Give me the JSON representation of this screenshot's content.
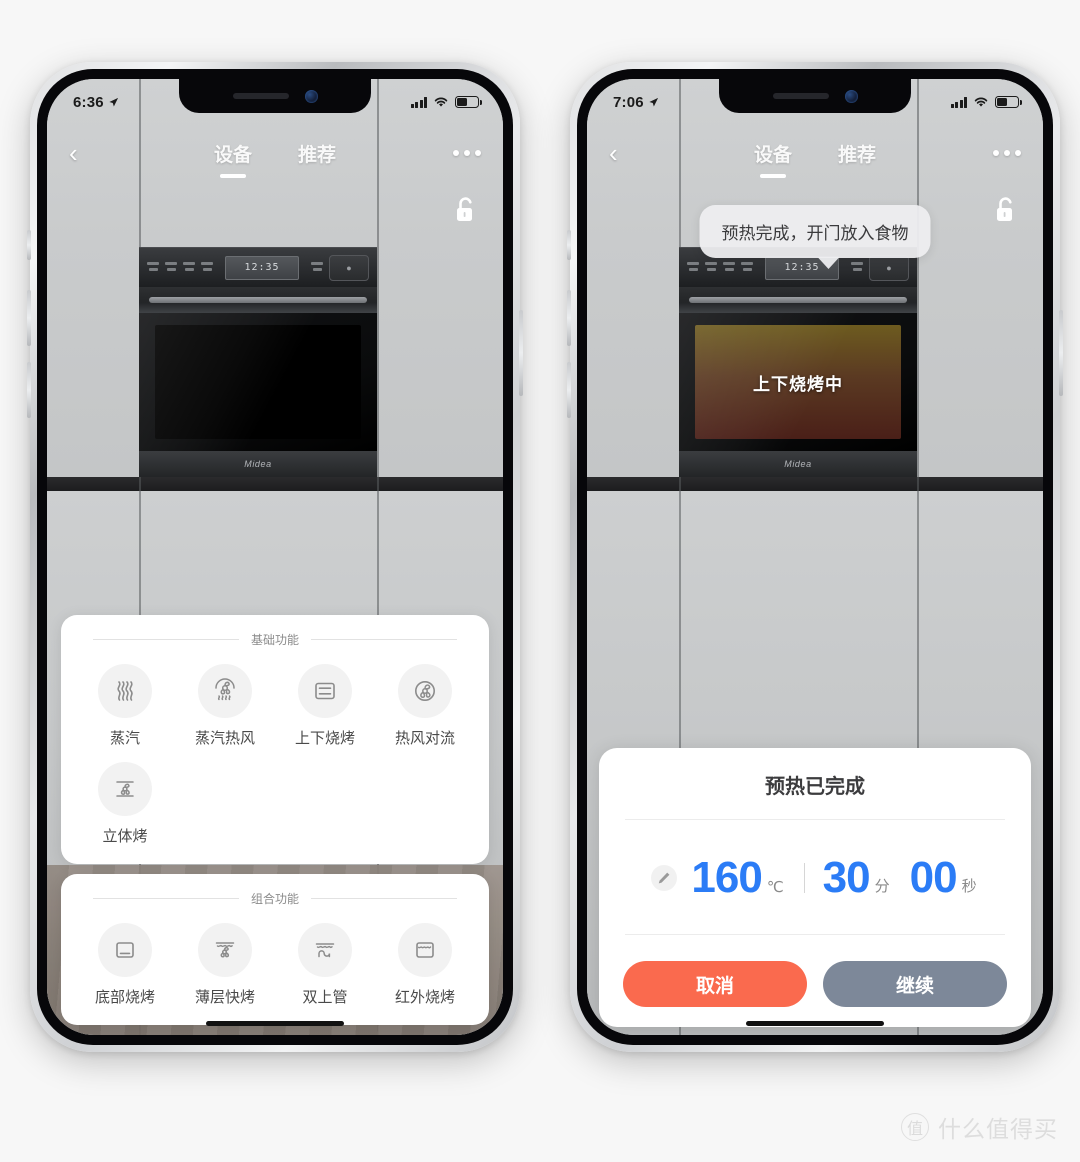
{
  "left_phone": {
    "status_bar": {
      "time": "6:36",
      "location_icon": "location-arrow-icon",
      "signal_icon": "cellular-bars-icon",
      "wifi_icon": "wifi-icon",
      "battery_icon": "battery-icon"
    },
    "navbar": {
      "back_icon": "chevron-left-icon",
      "tabs": [
        {
          "label": "设备",
          "active": true
        },
        {
          "label": "推荐",
          "active": false
        }
      ],
      "more_icon": "more-dots-icon"
    },
    "lock_icon": "unlock-icon",
    "oven": {
      "lcd_text": "12:35",
      "brand": "Midea",
      "state": "idle"
    },
    "cards": [
      {
        "title": "基础功能",
        "items": [
          {
            "label": "蒸汽",
            "icon": "steam-icon"
          },
          {
            "label": "蒸汽热风",
            "icon": "steam-fan-icon"
          },
          {
            "label": "上下烧烤",
            "icon": "top-bottom-grill-icon"
          },
          {
            "label": "热风对流",
            "icon": "convection-fan-icon"
          },
          {
            "label": "立体烤",
            "icon": "3d-bake-icon"
          }
        ]
      },
      {
        "title": "组合功能",
        "items": [
          {
            "label": "底部烧烤",
            "icon": "bottom-grill-icon"
          },
          {
            "label": "薄层快烤",
            "icon": "thin-layer-fast-bake-icon"
          },
          {
            "label": "双上管",
            "icon": "dual-top-heater-icon"
          },
          {
            "label": "红外烧烤",
            "icon": "infrared-grill-icon"
          }
        ]
      }
    ]
  },
  "right_phone": {
    "status_bar": {
      "time": "7:06",
      "location_icon": "location-arrow-icon",
      "signal_icon": "cellular-bars-icon",
      "wifi_icon": "wifi-icon",
      "battery_icon": "battery-icon"
    },
    "navbar": {
      "back_icon": "chevron-left-icon",
      "tabs": [
        {
          "label": "设备",
          "active": true
        },
        {
          "label": "推荐",
          "active": false
        }
      ],
      "more_icon": "more-dots-icon"
    },
    "lock_icon": "unlock-icon",
    "tooltip": "预热完成，开门放入食物",
    "oven": {
      "lcd_text": "12:35",
      "brand": "Midea",
      "state": "cooking",
      "cooking_text": "上下烧烤中"
    },
    "dialog": {
      "title": "预热已完成",
      "edit_icon": "pencil-icon",
      "temperature": "160",
      "temperature_unit": "℃",
      "minutes": "30",
      "minutes_unit": "分",
      "seconds": "00",
      "seconds_unit": "秒",
      "cancel_label": "取消",
      "confirm_label": "继续",
      "cancel_color": "#fa6a4e",
      "confirm_color": "#7d8899",
      "value_color": "#2b7cf6"
    }
  },
  "watermark": {
    "logo": "值",
    "text": "什么值得买"
  }
}
